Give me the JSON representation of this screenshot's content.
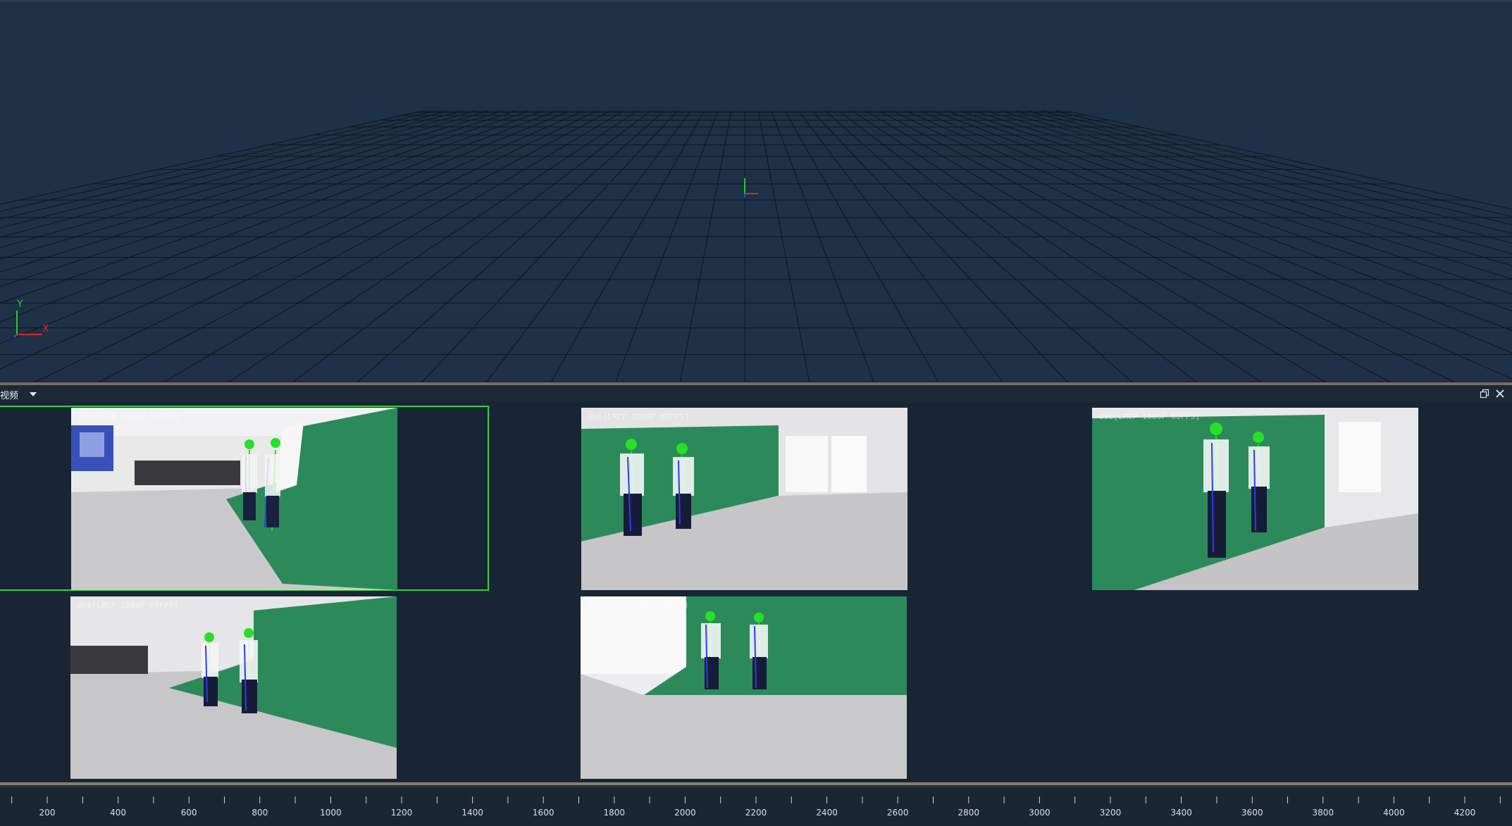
{
  "viewport": {
    "axis_labels": {
      "y": "Y",
      "x": "X"
    },
    "colors": {
      "background": "#1e3146",
      "grid": "#0d1622",
      "x_axis": "#d42a2a",
      "y_axis": "#2ac82a",
      "z_axis": "#2a4ad4"
    }
  },
  "video_panel": {
    "title": "视频",
    "cameras": [
      {
        "label": "Usb[LRCP 1080P 60FPS]",
        "selected": true
      },
      {
        "label": "Usb[LRCP 1080P 60FPS]",
        "selected": false
      },
      {
        "label": "Usb[LRCP 1080P 60FPS]",
        "selected": false
      },
      {
        "label": "Usb[LRCP 1080P 60FPS]",
        "selected": false
      },
      {
        "label": "Usb[LRCP 1080P 60FPS]",
        "selected": false
      }
    ],
    "colors": {
      "selection": "#34d234",
      "skeleton_green": "#27e027",
      "skeleton_blue": "#2a3cf0",
      "screen_green": "#2c8a5a"
    }
  },
  "timeline": {
    "ticks": [
      "200",
      "400",
      "600",
      "800",
      "1000",
      "1200",
      "1400",
      "1600",
      "1800",
      "2000",
      "2200",
      "2400",
      "2600",
      "2800",
      "3000",
      "3200",
      "3400",
      "3600",
      "3800",
      "4000",
      "4200"
    ]
  }
}
